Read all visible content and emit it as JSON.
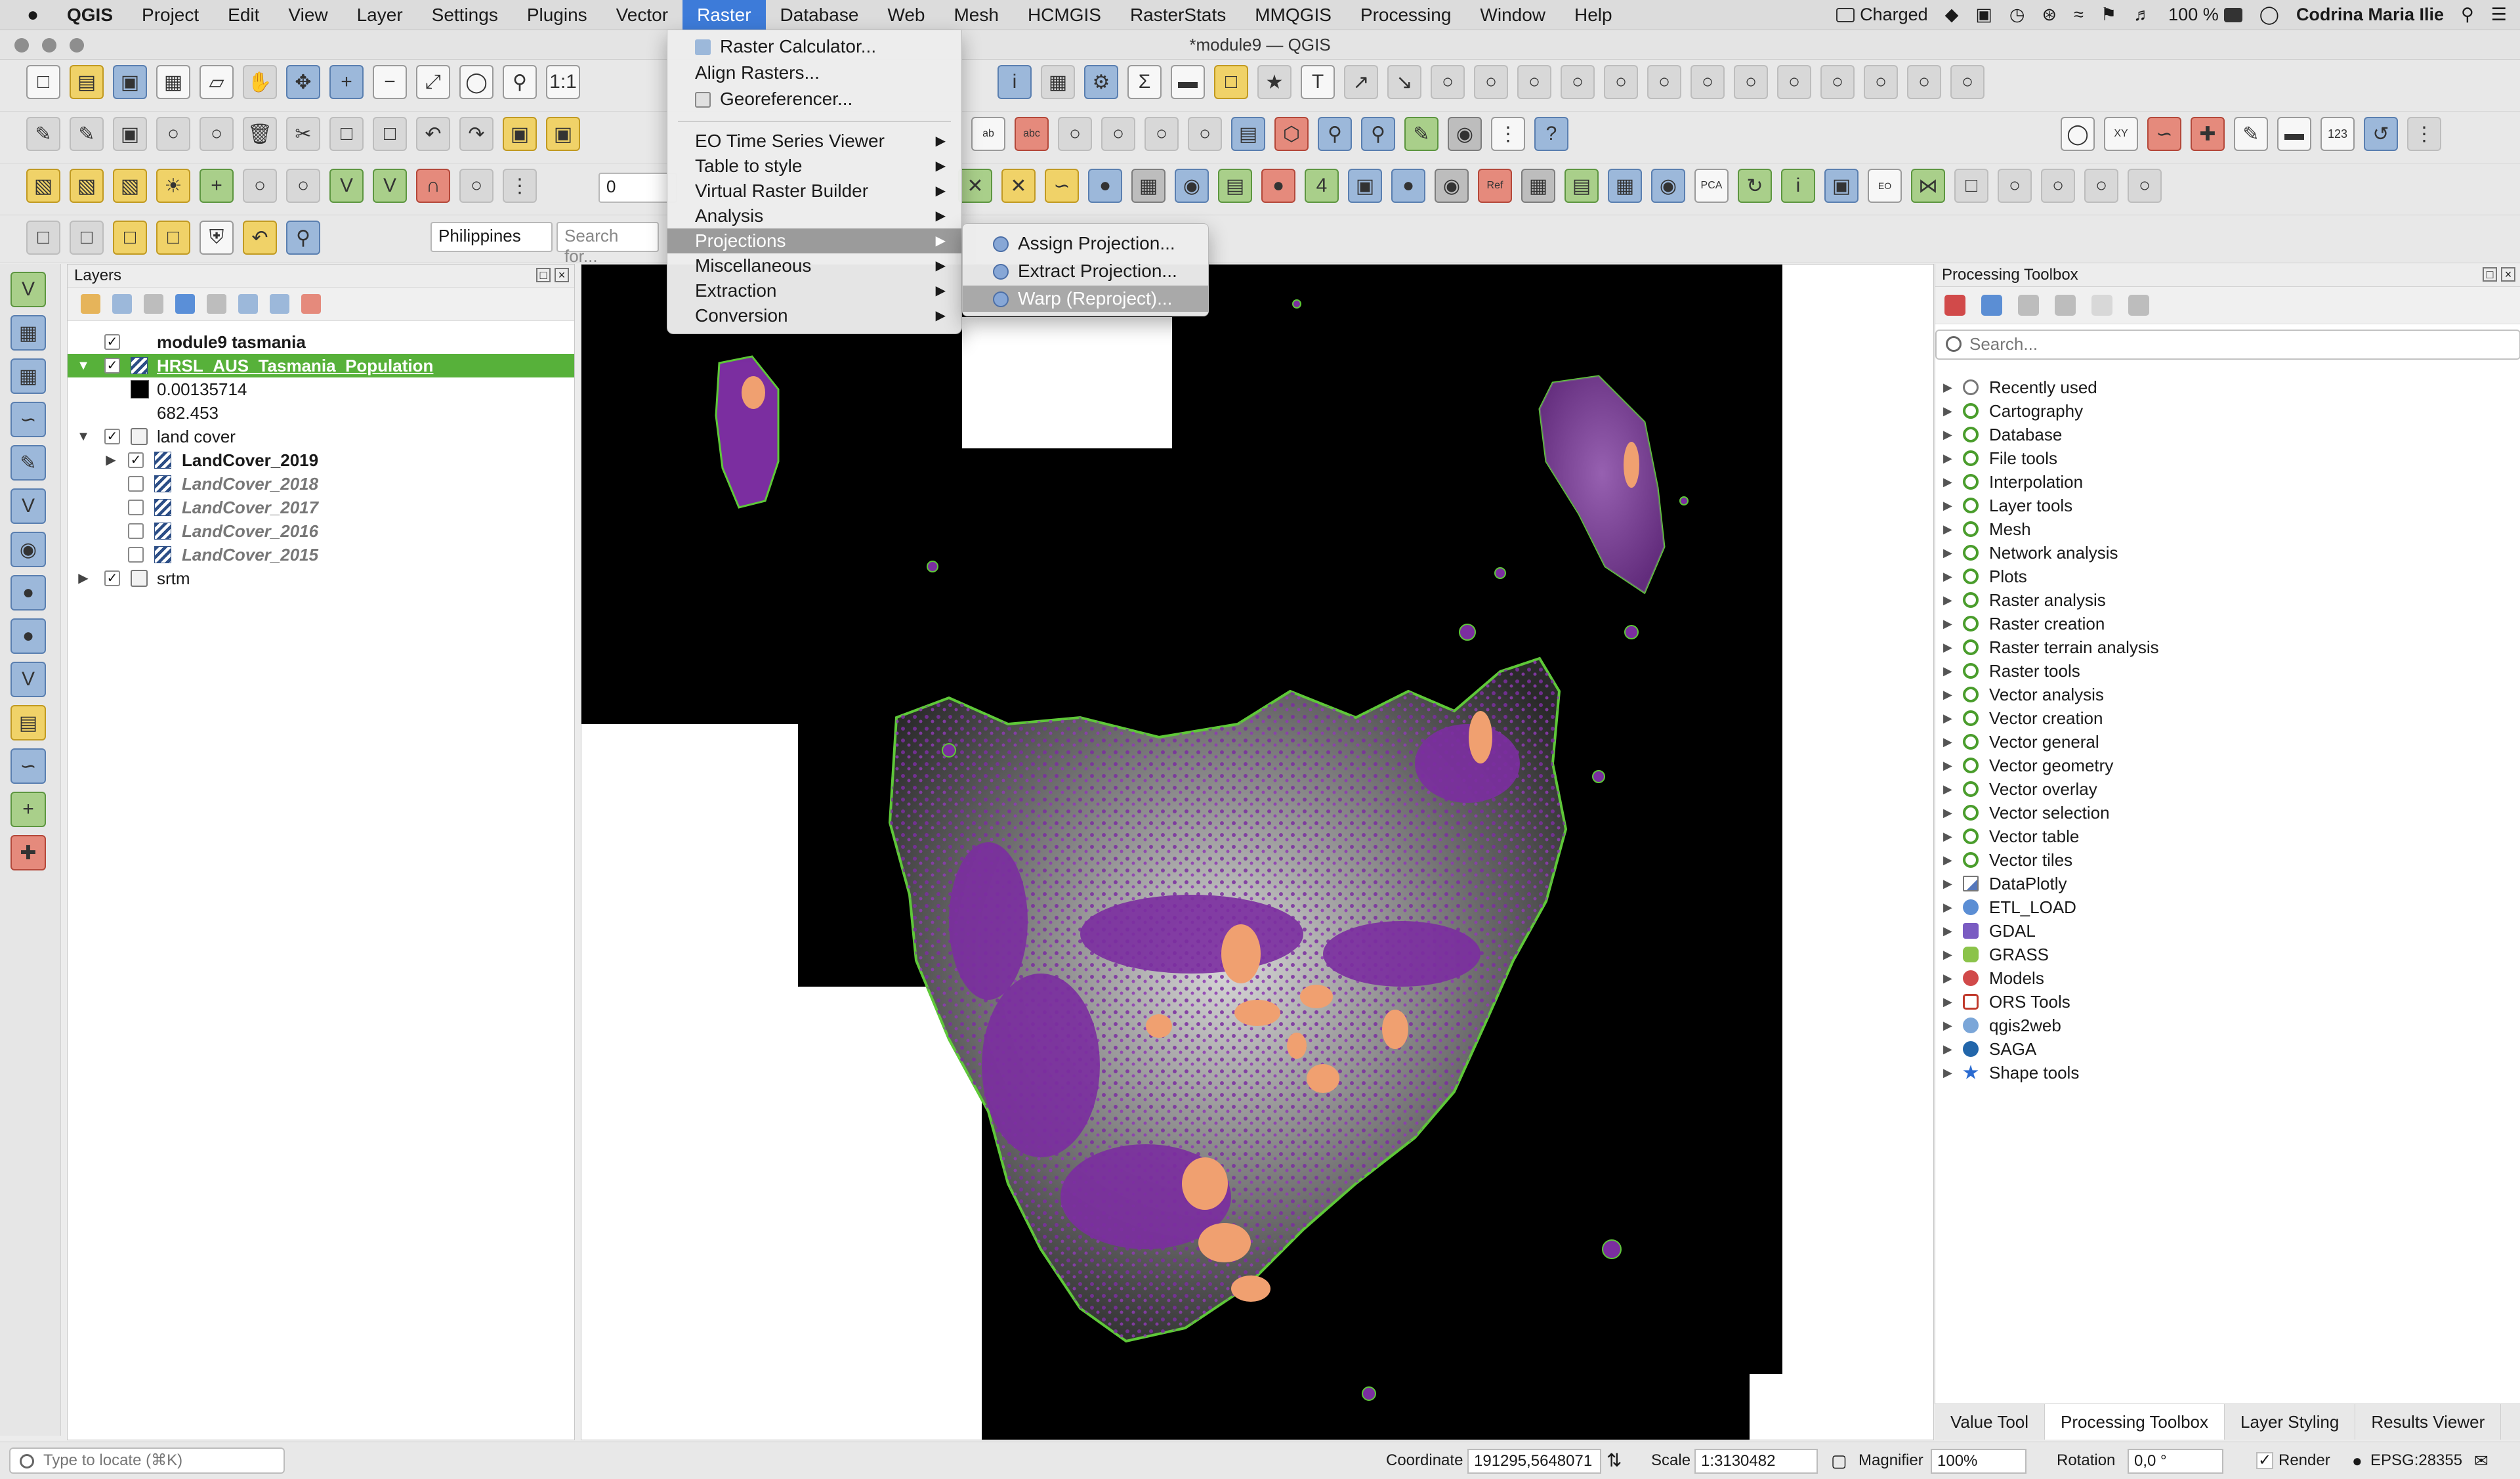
{
  "menubar": {
    "app": "QGIS",
    "items": [
      "Project",
      "Edit",
      "View",
      "Layer",
      "Settings",
      "Plugins",
      "Vector",
      "Raster",
      "Database",
      "Web",
      "Mesh",
      "HCMGIS",
      "RasterStats",
      "MMQGIS",
      "Processing",
      "Window",
      "Help"
    ],
    "active": "Raster",
    "status": {
      "battery_text": "Charged",
      "battery_percent": "100 %",
      "user": "Codrina Maria Ilie"
    }
  },
  "window": {
    "title": "*module9 — QGIS"
  },
  "toolbar": {
    "snap_value": "0",
    "locator_value": "Philippines",
    "search_placeholder": "Search for..."
  },
  "raster_menu": {
    "items": [
      {
        "label": "Raster Calculator...",
        "icon": "raster-calculator-icon",
        "submenu": false
      },
      {
        "label": "Align Rasters...",
        "icon": "align-rasters-icon",
        "submenu": false
      },
      {
        "label": "Georeferencer...",
        "icon": "georeferencer-icon",
        "submenu": false
      },
      {
        "label": "EO Time Series Viewer",
        "submenu": true
      },
      {
        "label": "Table to style",
        "submenu": true
      },
      {
        "label": "Virtual Raster Builder",
        "submenu": true
      },
      {
        "label": "Analysis",
        "submenu": true
      },
      {
        "label": "Projections",
        "submenu": true,
        "highlighted": true
      },
      {
        "label": "Miscellaneous",
        "submenu": true
      },
      {
        "label": "Extraction",
        "submenu": true
      },
      {
        "label": "Conversion",
        "submenu": true
      }
    ]
  },
  "projections_submenu": {
    "items": [
      {
        "label": "Assign Projection..."
      },
      {
        "label": "Extract Projection..."
      },
      {
        "label": "Warp (Reproject)...",
        "highlighted": true
      }
    ]
  },
  "layers_panel": {
    "title": "Layers",
    "rows": [
      {
        "label": "module9 tasmania",
        "type": "group",
        "checked": true,
        "bold": true
      },
      {
        "label": "HRSL_AUS_Tasmania_Population",
        "type": "raster",
        "checked": true,
        "selected": true
      },
      {
        "label": "0.00135714",
        "type": "legend",
        "swatch": "#000000"
      },
      {
        "label": "682.453",
        "type": "legend",
        "swatch": "#ffffff"
      },
      {
        "label": "land cover",
        "type": "group",
        "checked": true
      },
      {
        "label": "LandCover_2019",
        "type": "raster",
        "checked": true,
        "bold": true
      },
      {
        "label": "LandCover_2018",
        "type": "raster",
        "checked": false,
        "italic": true
      },
      {
        "label": "LandCover_2017",
        "type": "raster",
        "checked": false,
        "italic": true
      },
      {
        "label": "LandCover_2016",
        "type": "raster",
        "checked": false,
        "italic": true
      },
      {
        "label": "LandCover_2015",
        "type": "raster",
        "checked": false,
        "italic": true
      },
      {
        "label": "srtm",
        "type": "group",
        "checked": true
      }
    ]
  },
  "processing_panel": {
    "title": "Processing Toolbox",
    "search_placeholder": "Search...",
    "items": [
      {
        "label": "Recently used",
        "icon": "clock"
      },
      {
        "label": "Cartography",
        "icon": "q"
      },
      {
        "label": "Database",
        "icon": "q"
      },
      {
        "label": "File tools",
        "icon": "q"
      },
      {
        "label": "Interpolation",
        "icon": "q"
      },
      {
        "label": "Layer tools",
        "icon": "q"
      },
      {
        "label": "Mesh",
        "icon": "q"
      },
      {
        "label": "Network analysis",
        "icon": "q"
      },
      {
        "label": "Plots",
        "icon": "q"
      },
      {
        "label": "Raster analysis",
        "icon": "q"
      },
      {
        "label": "Raster creation",
        "icon": "q"
      },
      {
        "label": "Raster terrain analysis",
        "icon": "q"
      },
      {
        "label": "Raster tools",
        "icon": "q"
      },
      {
        "label": "Vector analysis",
        "icon": "q"
      },
      {
        "label": "Vector creation",
        "icon": "q"
      },
      {
        "label": "Vector general",
        "icon": "q"
      },
      {
        "label": "Vector geometry",
        "icon": "q"
      },
      {
        "label": "Vector overlay",
        "icon": "q"
      },
      {
        "label": "Vector selection",
        "icon": "q"
      },
      {
        "label": "Vector table",
        "icon": "q"
      },
      {
        "label": "Vector tiles",
        "icon": "q"
      },
      {
        "label": "DataPlotly",
        "icon": "chart"
      },
      {
        "label": "ETL_LOAD",
        "icon": "gear"
      },
      {
        "label": "GDAL",
        "icon": "gdal"
      },
      {
        "label": "GRASS",
        "icon": "grass"
      },
      {
        "label": "Models",
        "icon": "models"
      },
      {
        "label": "ORS Tools",
        "icon": "ors"
      },
      {
        "label": "qgis2web",
        "icon": "q2w"
      },
      {
        "label": "SAGA",
        "icon": "saga"
      },
      {
        "label": "Shape tools",
        "icon": "star"
      }
    ]
  },
  "bottom_tabs": [
    {
      "label": "Value Tool"
    },
    {
      "label": "Processing Toolbox",
      "active": true
    },
    {
      "label": "Layer Styling"
    },
    {
      "label": "Results Viewer"
    }
  ],
  "statusbar": {
    "locate_placeholder": "Type to locate (⌘K)",
    "coordinate_label": "Coordinate",
    "coordinate_value": "191295,5648071",
    "scale_label": "Scale",
    "scale_value": "1:3130482",
    "magnifier_label": "Magnifier",
    "magnifier_value": "100%",
    "rotation_label": "Rotation",
    "rotation_value": "0,0 °",
    "render_label": "Render",
    "render_checked": true,
    "crs": "EPSG:28355"
  },
  "colors": {
    "selection_green": "#57b13a",
    "menu_highlight": "#9b9b9b",
    "landcover_purple": "#7b2ea0",
    "landcover_orange": "#f0a070",
    "coastline_green": "#5ec838"
  }
}
